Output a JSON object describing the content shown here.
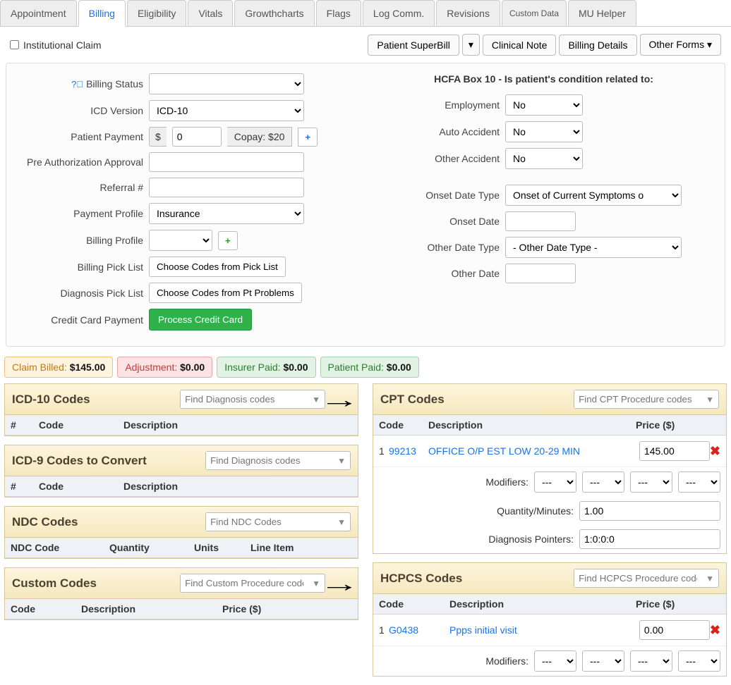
{
  "tabs": [
    "Appointment",
    "Billing",
    "Eligibility",
    "Vitals",
    "Growthcharts",
    "Flags",
    "Log Comm.",
    "Revisions",
    "Custom Data",
    "MU Helper"
  ],
  "active_tab": "Billing",
  "institutional_claim_label": "Institutional Claim",
  "topbuttons": {
    "superbill": "Patient SuperBill",
    "clinical_note": "Clinical Note",
    "billing_details": "Billing Details",
    "other_forms": "Other Forms"
  },
  "form_left": {
    "billing_status": "Billing Status",
    "icd_version": "ICD Version",
    "icd_version_value": "ICD-10",
    "patient_payment": "Patient Payment",
    "currency": "$",
    "payment_value": "0",
    "copay": "Copay: $20",
    "pre_auth": "Pre Authorization Approval",
    "referral": "Referral #",
    "payment_profile": "Payment Profile",
    "payment_profile_value": "Insurance",
    "billing_profile": "Billing Profile",
    "billing_pick": "Billing Pick List",
    "billing_pick_btn": "Choose Codes from Pick List",
    "diag_pick": "Diagnosis Pick List",
    "diag_pick_btn": "Choose Codes from Pt Problems",
    "cc_payment": "Credit Card Payment",
    "cc_btn": "Process Credit Card"
  },
  "hcfa": {
    "title": "HCFA Box 10 - Is patient's condition related to:",
    "employment": "Employment",
    "auto": "Auto Accident",
    "other_acc": "Other Accident",
    "no": "No",
    "onset_type": "Onset Date Type",
    "onset_type_value": "Onset of Current Symptoms o",
    "onset_date": "Onset Date",
    "other_date_type": "Other Date Type",
    "other_date_type_value": "- Other Date Type -",
    "other_date": "Other Date"
  },
  "summary": {
    "claim_billed_l": "Claim Billed:",
    "claim_billed_v": "$145.00",
    "adjustment_l": "Adjustment:",
    "adjustment_v": "$0.00",
    "insurer_l": "Insurer Paid:",
    "insurer_v": "$0.00",
    "patient_l": "Patient Paid:",
    "patient_v": "$0.00"
  },
  "boxes": {
    "icd10": {
      "title": "ICD-10 Codes",
      "search": "Find Diagnosis codes",
      "h": [
        "#",
        "Code",
        "Description"
      ]
    },
    "icd9": {
      "title": "ICD-9 Codes to Convert",
      "search": "Find Diagnosis codes",
      "h": [
        "#",
        "Code",
        "Description"
      ]
    },
    "ndc": {
      "title": "NDC Codes",
      "search": "Find NDC Codes",
      "h": [
        "NDC Code",
        "Quantity",
        "Units",
        "Line Item"
      ]
    },
    "custom": {
      "title": "Custom Codes",
      "search": "Find Custom Procedure codes",
      "h": [
        "Code",
        "Description",
        "Price ($)"
      ]
    },
    "cpt": {
      "title": "CPT Codes",
      "search": "Find CPT Procedure codes",
      "h": [
        "Code",
        "Description",
        "Price ($)"
      ]
    },
    "hcpcs": {
      "title": "HCPCS Codes",
      "search": "Find HCPCS Procedure codes",
      "h": [
        "Code",
        "Description",
        "Price ($)"
      ]
    }
  },
  "cpt_row": {
    "idx": "1",
    "code": "99213",
    "desc": "OFFICE O/P EST LOW 20-29 MIN",
    "price": "145.00",
    "modifiers_l": "Modifiers:",
    "dash": "---",
    "qty_l": "Quantity/Minutes:",
    "qty": "1.00",
    "dp_l": "Diagnosis Pointers:",
    "dp": "1:0:0:0"
  },
  "hcpcs_row": {
    "idx": "1",
    "code": "G0438",
    "desc": "Ppps initial visit",
    "price": "0.00",
    "modifiers_l": "Modifiers:",
    "dash": "---"
  }
}
